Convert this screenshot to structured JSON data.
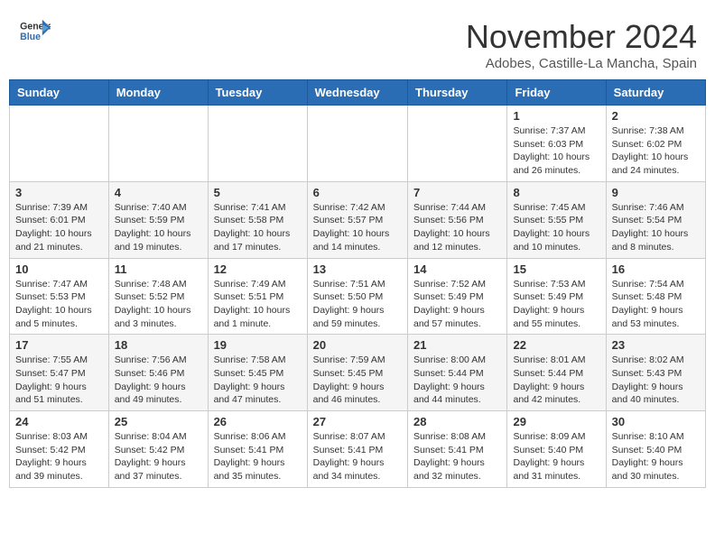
{
  "header": {
    "logo_line1": "General",
    "logo_line2": "Blue",
    "month": "November 2024",
    "location": "Adobes, Castille-La Mancha, Spain"
  },
  "weekdays": [
    "Sunday",
    "Monday",
    "Tuesday",
    "Wednesday",
    "Thursday",
    "Friday",
    "Saturday"
  ],
  "weeks": [
    [
      {
        "day": "",
        "info": ""
      },
      {
        "day": "",
        "info": ""
      },
      {
        "day": "",
        "info": ""
      },
      {
        "day": "",
        "info": ""
      },
      {
        "day": "",
        "info": ""
      },
      {
        "day": "1",
        "info": "Sunrise: 7:37 AM\nSunset: 6:03 PM\nDaylight: 10 hours and 26 minutes."
      },
      {
        "day": "2",
        "info": "Sunrise: 7:38 AM\nSunset: 6:02 PM\nDaylight: 10 hours and 24 minutes."
      }
    ],
    [
      {
        "day": "3",
        "info": "Sunrise: 7:39 AM\nSunset: 6:01 PM\nDaylight: 10 hours and 21 minutes."
      },
      {
        "day": "4",
        "info": "Sunrise: 7:40 AM\nSunset: 5:59 PM\nDaylight: 10 hours and 19 minutes."
      },
      {
        "day": "5",
        "info": "Sunrise: 7:41 AM\nSunset: 5:58 PM\nDaylight: 10 hours and 17 minutes."
      },
      {
        "day": "6",
        "info": "Sunrise: 7:42 AM\nSunset: 5:57 PM\nDaylight: 10 hours and 14 minutes."
      },
      {
        "day": "7",
        "info": "Sunrise: 7:44 AM\nSunset: 5:56 PM\nDaylight: 10 hours and 12 minutes."
      },
      {
        "day": "8",
        "info": "Sunrise: 7:45 AM\nSunset: 5:55 PM\nDaylight: 10 hours and 10 minutes."
      },
      {
        "day": "9",
        "info": "Sunrise: 7:46 AM\nSunset: 5:54 PM\nDaylight: 10 hours and 8 minutes."
      }
    ],
    [
      {
        "day": "10",
        "info": "Sunrise: 7:47 AM\nSunset: 5:53 PM\nDaylight: 10 hours and 5 minutes."
      },
      {
        "day": "11",
        "info": "Sunrise: 7:48 AM\nSunset: 5:52 PM\nDaylight: 10 hours and 3 minutes."
      },
      {
        "day": "12",
        "info": "Sunrise: 7:49 AM\nSunset: 5:51 PM\nDaylight: 10 hours and 1 minute."
      },
      {
        "day": "13",
        "info": "Sunrise: 7:51 AM\nSunset: 5:50 PM\nDaylight: 9 hours and 59 minutes."
      },
      {
        "day": "14",
        "info": "Sunrise: 7:52 AM\nSunset: 5:49 PM\nDaylight: 9 hours and 57 minutes."
      },
      {
        "day": "15",
        "info": "Sunrise: 7:53 AM\nSunset: 5:49 PM\nDaylight: 9 hours and 55 minutes."
      },
      {
        "day": "16",
        "info": "Sunrise: 7:54 AM\nSunset: 5:48 PM\nDaylight: 9 hours and 53 minutes."
      }
    ],
    [
      {
        "day": "17",
        "info": "Sunrise: 7:55 AM\nSunset: 5:47 PM\nDaylight: 9 hours and 51 minutes."
      },
      {
        "day": "18",
        "info": "Sunrise: 7:56 AM\nSunset: 5:46 PM\nDaylight: 9 hours and 49 minutes."
      },
      {
        "day": "19",
        "info": "Sunrise: 7:58 AM\nSunset: 5:45 PM\nDaylight: 9 hours and 47 minutes."
      },
      {
        "day": "20",
        "info": "Sunrise: 7:59 AM\nSunset: 5:45 PM\nDaylight: 9 hours and 46 minutes."
      },
      {
        "day": "21",
        "info": "Sunrise: 8:00 AM\nSunset: 5:44 PM\nDaylight: 9 hours and 44 minutes."
      },
      {
        "day": "22",
        "info": "Sunrise: 8:01 AM\nSunset: 5:44 PM\nDaylight: 9 hours and 42 minutes."
      },
      {
        "day": "23",
        "info": "Sunrise: 8:02 AM\nSunset: 5:43 PM\nDaylight: 9 hours and 40 minutes."
      }
    ],
    [
      {
        "day": "24",
        "info": "Sunrise: 8:03 AM\nSunset: 5:42 PM\nDaylight: 9 hours and 39 minutes."
      },
      {
        "day": "25",
        "info": "Sunrise: 8:04 AM\nSunset: 5:42 PM\nDaylight: 9 hours and 37 minutes."
      },
      {
        "day": "26",
        "info": "Sunrise: 8:06 AM\nSunset: 5:41 PM\nDaylight: 9 hours and 35 minutes."
      },
      {
        "day": "27",
        "info": "Sunrise: 8:07 AM\nSunset: 5:41 PM\nDaylight: 9 hours and 34 minutes."
      },
      {
        "day": "28",
        "info": "Sunrise: 8:08 AM\nSunset: 5:41 PM\nDaylight: 9 hours and 32 minutes."
      },
      {
        "day": "29",
        "info": "Sunrise: 8:09 AM\nSunset: 5:40 PM\nDaylight: 9 hours and 31 minutes."
      },
      {
        "day": "30",
        "info": "Sunrise: 8:10 AM\nSunset: 5:40 PM\nDaylight: 9 hours and 30 minutes."
      }
    ]
  ]
}
